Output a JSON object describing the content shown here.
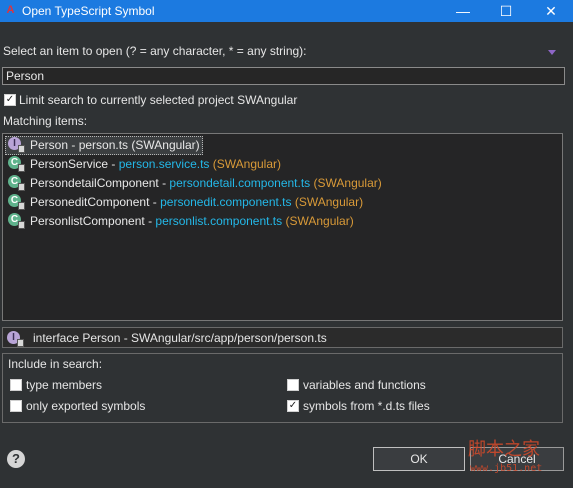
{
  "window": {
    "title": "Open TypeScript Symbol",
    "app_icon": "angular-icon",
    "controls": {
      "minimize": "—",
      "maximize": "☐",
      "close": "✕"
    }
  },
  "prompt": {
    "label": "Select an item to open (? = any character, * = any string):"
  },
  "search": {
    "value": "Person",
    "placeholder": ""
  },
  "limit_checkbox": {
    "checked": true,
    "label": "Limit search to currently selected project SWAngular"
  },
  "matching": {
    "label": "Matching items:",
    "items": [
      {
        "icon": "interface-icon",
        "name": "Person",
        "hint": " - person.ts (SWAngular)",
        "file": "",
        "project": "",
        "selected": true
      },
      {
        "icon": "class-icon",
        "name": "PersonService",
        "hint": " - ",
        "file": "person.service.ts",
        "project": " (SWAngular)",
        "selected": false
      },
      {
        "icon": "class-icon",
        "name": "PersondetailComponent",
        "hint": " - ",
        "file": "persondetail.component.ts",
        "project": " (SWAngular)",
        "selected": false
      },
      {
        "icon": "class-icon",
        "name": "PersoneditComponent",
        "hint": " - ",
        "file": "personedit.component.ts",
        "project": " (SWAngular)",
        "selected": false
      },
      {
        "icon": "class-icon",
        "name": "PersonlistComponent",
        "hint": " - ",
        "file": "personlist.component.ts",
        "project": " (SWAngular)",
        "selected": false
      }
    ]
  },
  "details": {
    "text": "interface Person - SWAngular/src/app/person/person.ts"
  },
  "include": {
    "title": "Include in search:",
    "options": [
      {
        "label": "type members",
        "checked": false
      },
      {
        "label": "only exported symbols",
        "checked": false
      },
      {
        "label": "variables and functions",
        "checked": false
      },
      {
        "label": "symbols from *.d.ts files",
        "checked": true
      }
    ]
  },
  "buttons": {
    "help": "?",
    "ok": "OK",
    "cancel": "Cancel"
  },
  "watermark": {
    "main": "脚本之家",
    "sub": "www.jb51.net"
  },
  "colors": {
    "titlebar": "#1c7ae0",
    "background": "#2f3234",
    "file_link": "#24b8e8",
    "project_text": "#d99a38"
  }
}
